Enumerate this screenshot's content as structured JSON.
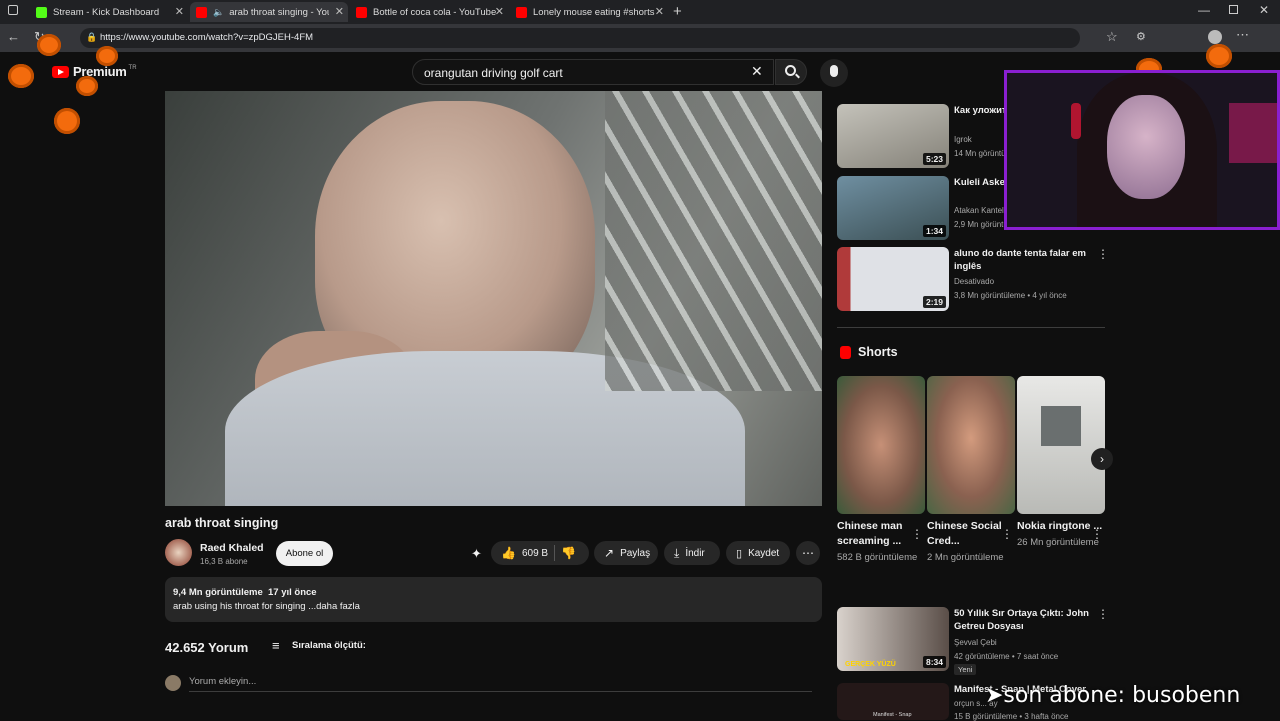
{
  "browser": {
    "tabs": [
      {
        "label": "Stream - Kick Dashboard",
        "color": "#53fc18"
      },
      {
        "label": "arab throat singing - YouTub",
        "color": "#ff0000"
      },
      {
        "label": "Bottle of coca cola - YouTube",
        "color": "#ff0000"
      },
      {
        "label": "Lonely mouse eating #shorts - Yo",
        "color": "#ff0000"
      }
    ],
    "url": "https://www.youtube.com/watch?v=zpDGJEH-4FM"
  },
  "header": {
    "logo": "Premium",
    "logo_region": "TR",
    "search_value": "orangutan driving golf cart"
  },
  "video": {
    "title": "arab throat singing",
    "channel": "Raed Khaled",
    "subscribers": "16,3 B abone",
    "subscribe_label": "Abone ol",
    "likes": "609 B",
    "share_label": "Paylaş",
    "download_label": "İndir",
    "save_label": "Kaydet",
    "views_date": "9,4 Mn görüntüleme  17 yıl önce",
    "description": "arab using his throat for singing ...daha fazla"
  },
  "comments": {
    "count": "42.652 Yorum",
    "sort_label": "Sıralama ölçütü:",
    "add_placeholder": "Yorum ekleyin..."
  },
  "related": [
    {
      "title": "Как уложить ... и рук",
      "channel": "Igrok",
      "meta": "14 Mn görüntü",
      "duration": "5:23"
    },
    {
      "title": "Kuleli Asker ... Oluyor Haya",
      "channel": "Atakan Kantel",
      "meta": "2,9 Mn görüntü",
      "duration": "1:34"
    },
    {
      "title": "aluno do dante tenta falar em inglês",
      "channel": "Desativado",
      "meta": "3,8 Mn görüntüleme • 4 yıl önce",
      "duration": "2:19"
    }
  ],
  "shorts": {
    "heading": "Shorts",
    "items": [
      {
        "title": "Chinese man screaming ...",
        "views": "582 B görüntüleme"
      },
      {
        "title": "Chinese Social Cred...",
        "views": "2 Mn görüntüleme"
      },
      {
        "title": "Nokia ringtone ...",
        "views": "26 Mn görüntüleme"
      }
    ]
  },
  "related_bottom": [
    {
      "title": "50 Yıllık Sır Ortaya Çıktı: John Getreu Dosyası",
      "channel": "Şevval Çebi",
      "meta": "42 görüntüleme • 7 saat önce",
      "badge": "Yeni",
      "duration": "8:34",
      "thumb_text": "GERÇEK YÜZÜ"
    },
    {
      "title": "Manifest - Snap | Metal Cover",
      "channel": "orçun s... ay",
      "meta": "15 B görüntüleme • 3 hafta önce",
      "thumb_text": "Manifest - Snap"
    }
  ],
  "overlay": {
    "text": "➤son abone: busobenn"
  }
}
